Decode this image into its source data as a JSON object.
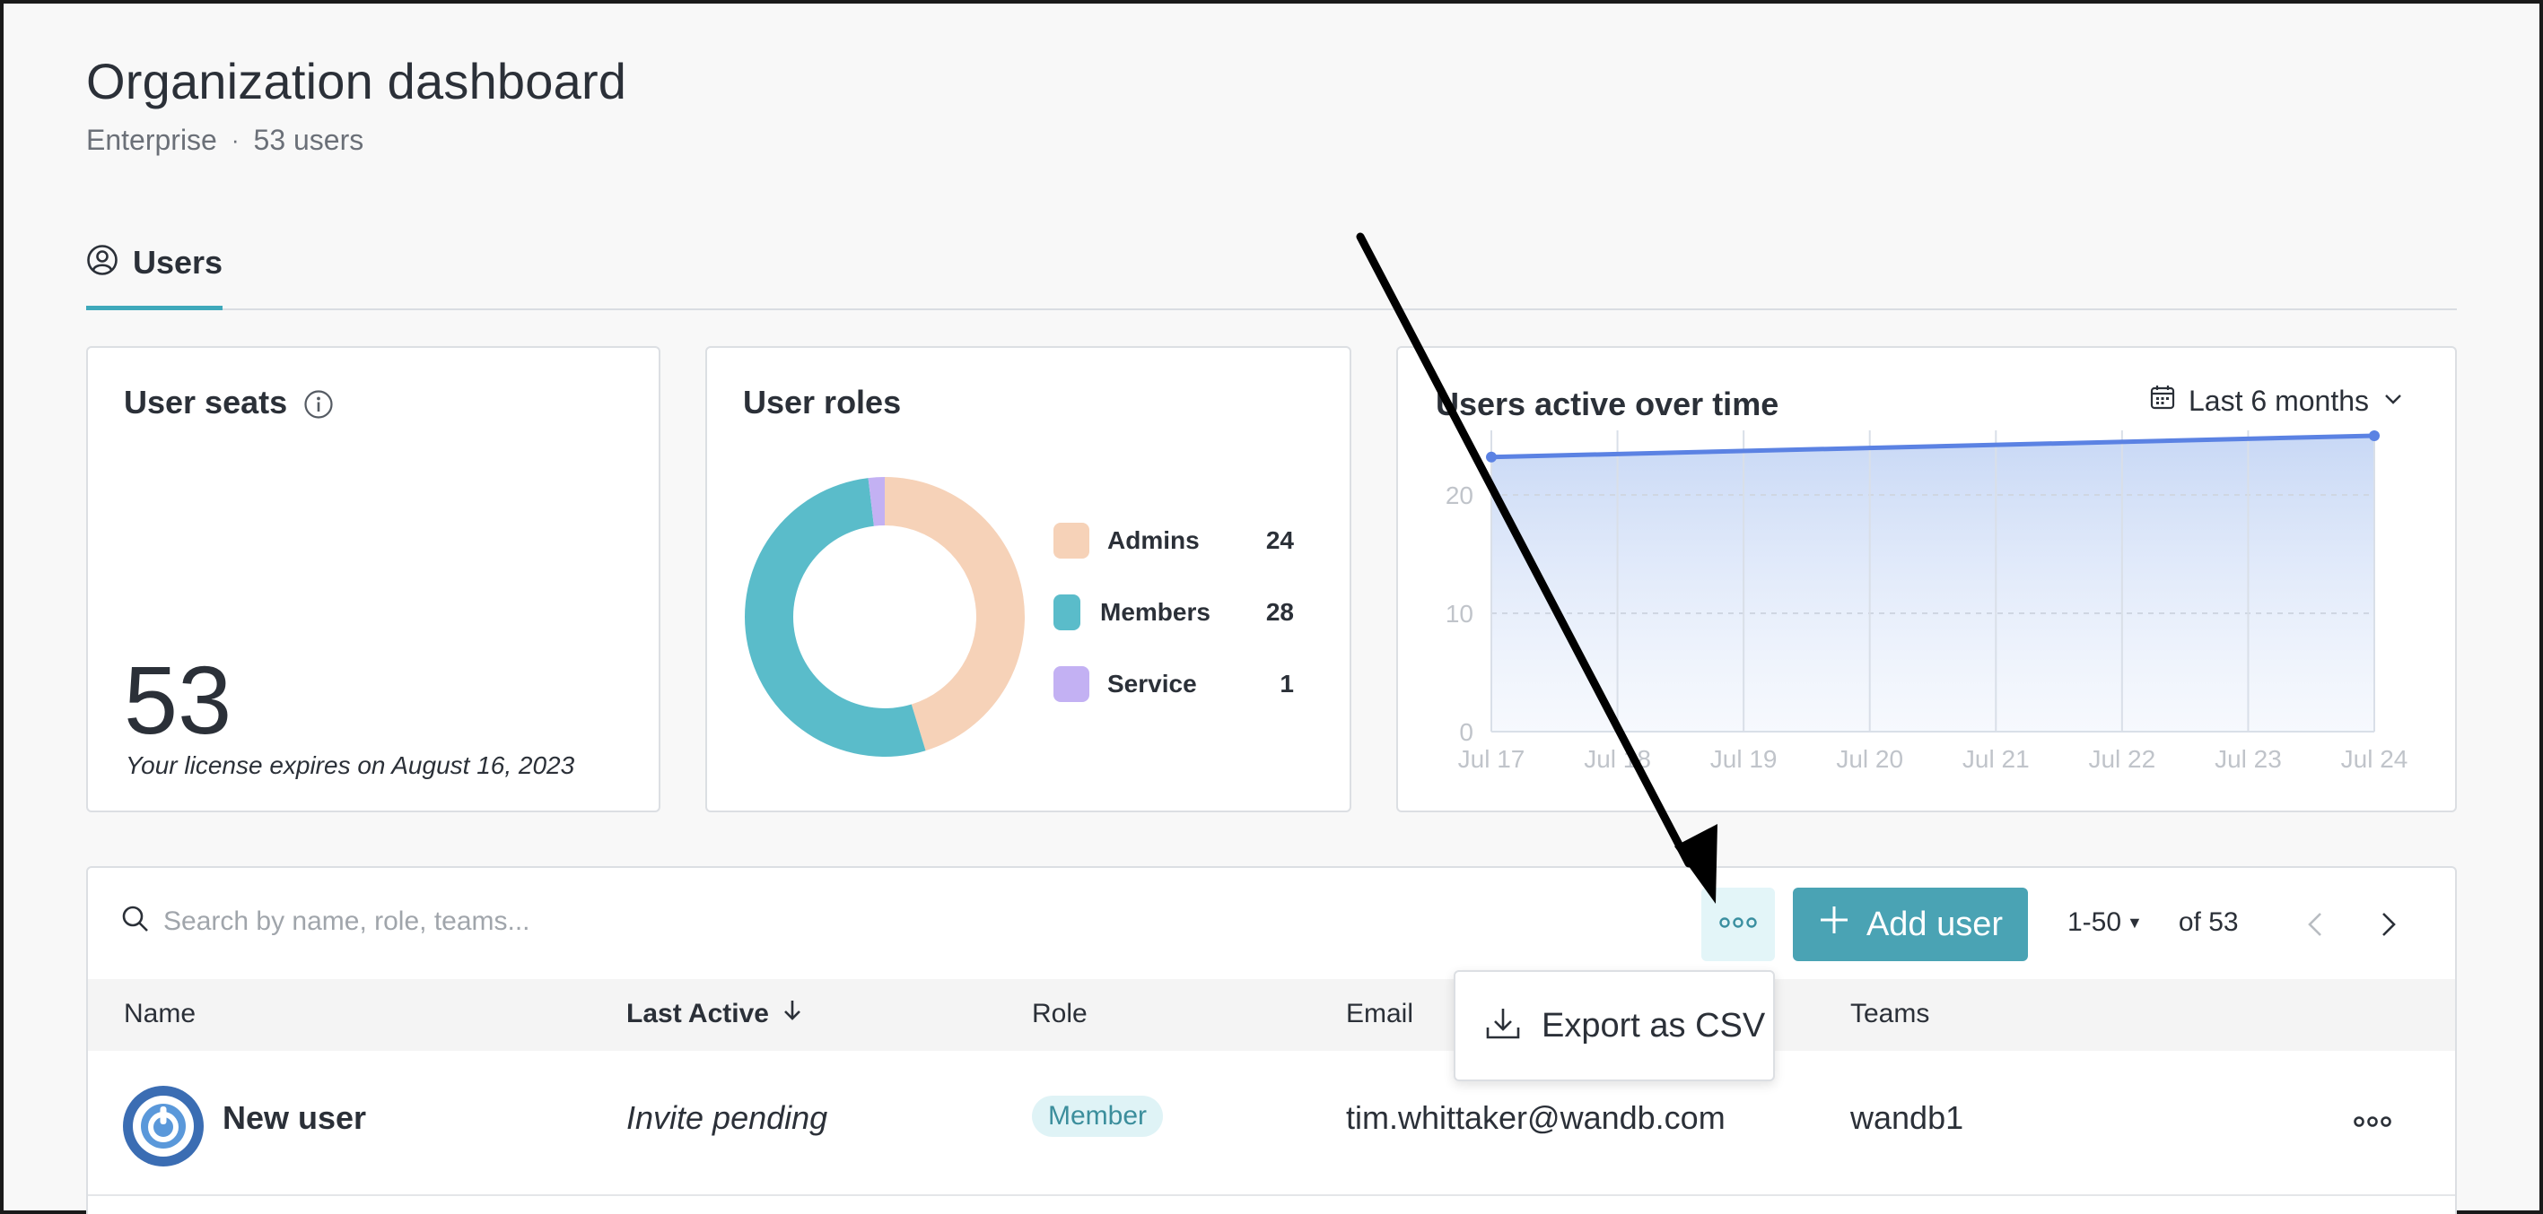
{
  "header": {
    "title": "Organization dashboard",
    "plan": "Enterprise",
    "separator": "·",
    "user_count": "53 users"
  },
  "tabs": [
    {
      "label": "Users",
      "icon": "user-circle-icon"
    }
  ],
  "seats_card": {
    "title": "User seats",
    "value": "53",
    "license_note": "Your license expires on August 16, 2023"
  },
  "roles_card": {
    "title": "User roles",
    "legend": [
      {
        "label": "Admins",
        "value": "24",
        "color": "#f6d2b8"
      },
      {
        "label": "Members",
        "value": "28",
        "color": "#5abcca"
      },
      {
        "label": "Service",
        "value": "1",
        "color": "#c3b1f3"
      }
    ]
  },
  "activity_card": {
    "title": "Users active over time",
    "range_label": "Last 6 months"
  },
  "chart_data": [
    {
      "type": "pie",
      "title": "User roles",
      "categories": [
        "Admins",
        "Members",
        "Service"
      ],
      "values": [
        24,
        28,
        1
      ],
      "colors": [
        "#f6d2b8",
        "#5abcca",
        "#c3b1f3"
      ],
      "donut": true
    },
    {
      "type": "area",
      "title": "Users active over time",
      "x": [
        "Jul 17",
        "Jul 18",
        "Jul 19",
        "Jul 20",
        "Jul 21",
        "Jul 22",
        "Jul 23",
        "Jul 24"
      ],
      "series": [
        {
          "values": [
            23.2,
            null,
            null,
            null,
            null,
            null,
            null,
            25.0
          ]
        }
      ],
      "y_ticks": [
        "0",
        "10",
        "20"
      ],
      "ylim": [
        0,
        25
      ],
      "grid": true,
      "color": "#5b82e3"
    }
  ],
  "toolbar": {
    "search_placeholder": "Search by name, role, teams...",
    "add_user_label": "Add user",
    "page_range": "1-50",
    "page_total": "of 53"
  },
  "table": {
    "columns": [
      "Name",
      "Last Active",
      "Role",
      "Email",
      "Teams"
    ],
    "rows": [
      {
        "name": "New user",
        "last_active": "Invite pending",
        "role": "Member",
        "email": "tim.whittaker@wandb.com",
        "teams": "wandb1"
      }
    ]
  },
  "menu": {
    "export_label": "Export as CSV"
  },
  "colors": {
    "accent": "#4aa3b4",
    "line": "#5b82e3",
    "annotation_arrow": "#000000"
  }
}
